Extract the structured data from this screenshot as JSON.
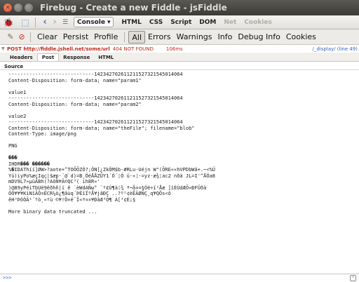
{
  "window": {
    "title": "Firebug - Create a new Fiddle - jsFiddle"
  },
  "toolbar": {
    "panel_selected": "Console",
    "panels": [
      "HTML",
      "CSS",
      "Script",
      "DOM",
      "Net",
      "Cookies"
    ],
    "disabled_panels": [
      "Net",
      "Cookies"
    ]
  },
  "consolebar": {
    "buttons": [
      "Clear",
      "Persist",
      "Profile",
      "All",
      "Errors",
      "Warnings",
      "Info",
      "Debug Info",
      "Cookies"
    ],
    "active": "All"
  },
  "request": {
    "line": "POST http://fiddle.jshell.net/some/url",
    "status": "404 NOT FOUND",
    "time": "106ms",
    "source": "/_display/ (line 49)"
  },
  "request_tabs": {
    "tabs": [
      "Headers",
      "Post",
      "Response",
      "HTML"
    ],
    "active": "Post"
  },
  "post": {
    "section_title": "Source",
    "body": "-----------------------------14234270261121152732154501406​4\nContent-Disposition: form-data; name=\"param1\"\n\nvalue1\n-----------------------------142342702611211527321545014064\nContent-Disposition: form-data; name=\"param2\"\n\nvalue2\n-----------------------------142342702611211527321545014064\nContent-Disposition: form-data; name=\"theFile\"; filename=\"blob\"\nContent-Type: image/png\n\nPNG\n\n���\nIHDR��� ������\n%�IDAThíí]ØW>?aote+^TOÕÕZÒ?;ÖN[¿ZkÖM$b-#RLu·Uéjn W\"(ÕRE««hVPDbWä+.~<%Ü\nYü)iyPo%æçIqç|$æp·¨@`d)=B¸ÖéÅÅZÛY1´Ó´¦Ó ü·«¦·=yz·æ¾¦ac2 nðà JL=I'^ÅÖa8\nmDV9L7»µüÄBh(?AôÑ¥Ã©QC³( ih8R«'\n)@89yPéiTbUë9ëðhñ|í ê `èWdAÑw° ¨º£Ù¶à¦¾ ª¬å¤¤§Óë÷ï²Åæ ]îÈÚdÆÕ«ÐFÛðä\nÓÓ¥¥¥KìNîÂÔ¤ËCR¼ö¿¶âùq´ÞÉîÏºÅ¥jâÐÇ ..?º²¢èÊÄØÑÇ¸q¥QÖs<õ\nêH³ÞôÒÂ¹´ºò¸«ºù ©¥!Ö×ë¯Î«ª¤¤¥ÐâÆ³Õ¶ À[³¢É¡§\n\nMore binary data truncated ..."
  },
  "commandline": {
    "prompt": ">>>"
  }
}
